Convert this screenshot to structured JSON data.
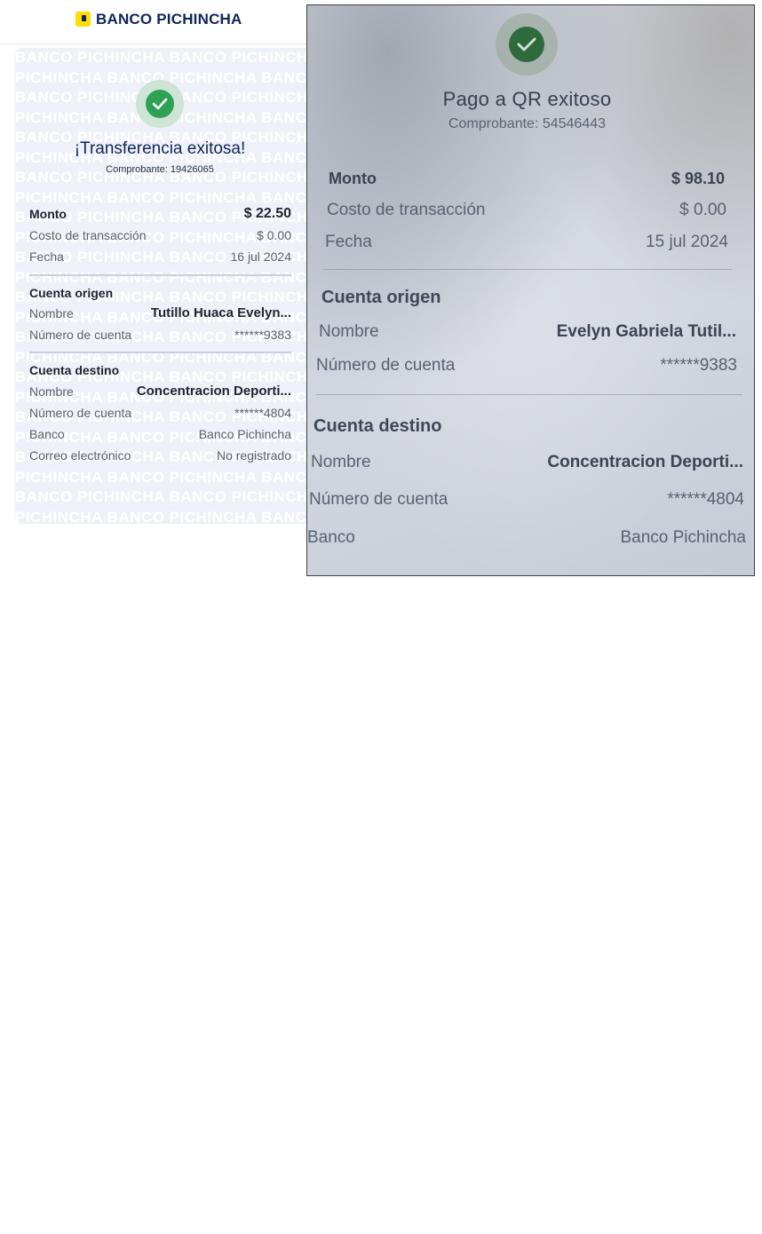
{
  "brand": {
    "name": "BANCO PICHINCHA",
    "watermark_text": "BANCO PICHINCHA",
    "primary_color": "#0f265c",
    "accent_color": "#ffdd00",
    "success_color": "#2fa155",
    "logo_icon": "banco-pichincha-logo-icon"
  },
  "receipt": {
    "status_icon": "check-circle-icon",
    "title": "¡Transferencia exitosa!",
    "receipt_number": "Comprobante: 19426065",
    "summary": [
      {
        "label": "Monto",
        "value": "$ 22.50"
      },
      {
        "label": "Costo de transacción",
        "value": "$ 0.00"
      },
      {
        "label": "Fecha",
        "value": "16 jul 2024"
      }
    ],
    "origin": {
      "title": "Cuenta origen",
      "rows": [
        {
          "label": "Nombre",
          "value": "Tutillo  Huaca Evelyn..."
        },
        {
          "label": "Número de cuenta",
          "value": "******9383"
        }
      ]
    },
    "destination": {
      "title": "Cuenta destino",
      "rows": [
        {
          "label": "Nombre",
          "value": "Concentracion Deporti..."
        },
        {
          "label": "Número de cuenta",
          "value": "******4804"
        },
        {
          "label": "Banco",
          "value": "Banco Pichincha"
        },
        {
          "label": "Correo electrónico",
          "value": "No registrado"
        }
      ]
    }
  },
  "photo_receipt": {
    "status_icon": "check-circle-icon",
    "title": "Pago a QR exitoso",
    "receipt_number": "Comprobante: 54546443",
    "summary": [
      {
        "label": "Monto",
        "value": "$ 98.10"
      },
      {
        "label": "Costo de transacción",
        "value": "$ 0.00"
      },
      {
        "label": "Fecha",
        "value": "15 jul 2024"
      }
    ],
    "origin": {
      "title": "Cuenta origen",
      "rows": [
        {
          "label": "Nombre",
          "value": "Evelyn Gabriela Tutil..."
        },
        {
          "label": "Número de cuenta",
          "value": "******9383"
        }
      ]
    },
    "destination": {
      "title": "Cuenta destino",
      "rows": [
        {
          "label": "Nombre",
          "value": "Concentracion Deporti..."
        },
        {
          "label": "Número de cuenta",
          "value": "******4804"
        },
        {
          "label": "Banco",
          "value": "Banco Pichincha"
        }
      ]
    }
  }
}
